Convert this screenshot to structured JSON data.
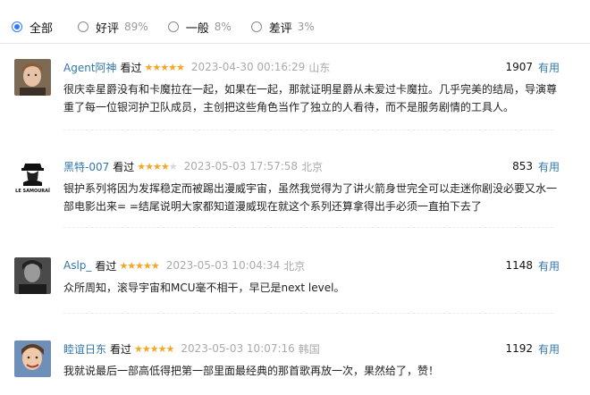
{
  "filters": [
    {
      "label": "全部",
      "pct": "",
      "checked": true
    },
    {
      "label": "好评",
      "pct": "89%",
      "checked": false
    },
    {
      "label": "一般",
      "pct": "8%",
      "checked": false
    },
    {
      "label": "差评",
      "pct": "3%",
      "checked": false
    }
  ],
  "comments": [
    {
      "user": "Agent阿神",
      "watched": "看过",
      "stars": 5,
      "time": "2023-04-30 00:16:29",
      "location": "山东",
      "votes": "1907",
      "useful_label": "有用",
      "text": "很庆幸星爵没有和卡魔拉在一起，如果在一起，那就证明星爵从未爱过卡魔拉。几乎完美的结局，导演尊重了每一位银河护卫队成员，主创把这些角色当作了独立的人看待，而不是服务剧情的工具人。"
    },
    {
      "user": "黑特-007",
      "watched": "看过",
      "stars": 4,
      "time": "2023-05-03 17:57:58",
      "location": "北京",
      "votes": "853",
      "useful_label": "有用",
      "avatar_text": "LE SAMOURAÏ",
      "text": "银护系列将因为发挥稳定而被踢出漫威宇宙，虽然我觉得为了讲火箭身世完全可以走迷你剧没必要又水一部电影出来= =结尾说明大家都知道漫威现在就这个系列还算拿得出手必须一直拍下去了"
    },
    {
      "user": "Aslp_",
      "watched": "看过",
      "stars": 5,
      "time": "2023-05-03 10:04:34",
      "location": "北京",
      "votes": "1148",
      "useful_label": "有用",
      "text": "众所周知，滚导宇宙和MCU毫不相干，早已是next level。"
    },
    {
      "user": "睦谊日东",
      "watched": "看过",
      "stars": 5,
      "time": "2023-05-03 10:07:16",
      "location": "韩国",
      "votes": "1192",
      "useful_label": "有用",
      "text": "我就说最后一部高低得把第一部里面最经典的那首歌再放一次，果然给了，赞！"
    }
  ],
  "colors": {
    "accent": "#3377ff",
    "link": "#3377aa",
    "star": "#f5a623",
    "muted": "#aaaaaa"
  }
}
